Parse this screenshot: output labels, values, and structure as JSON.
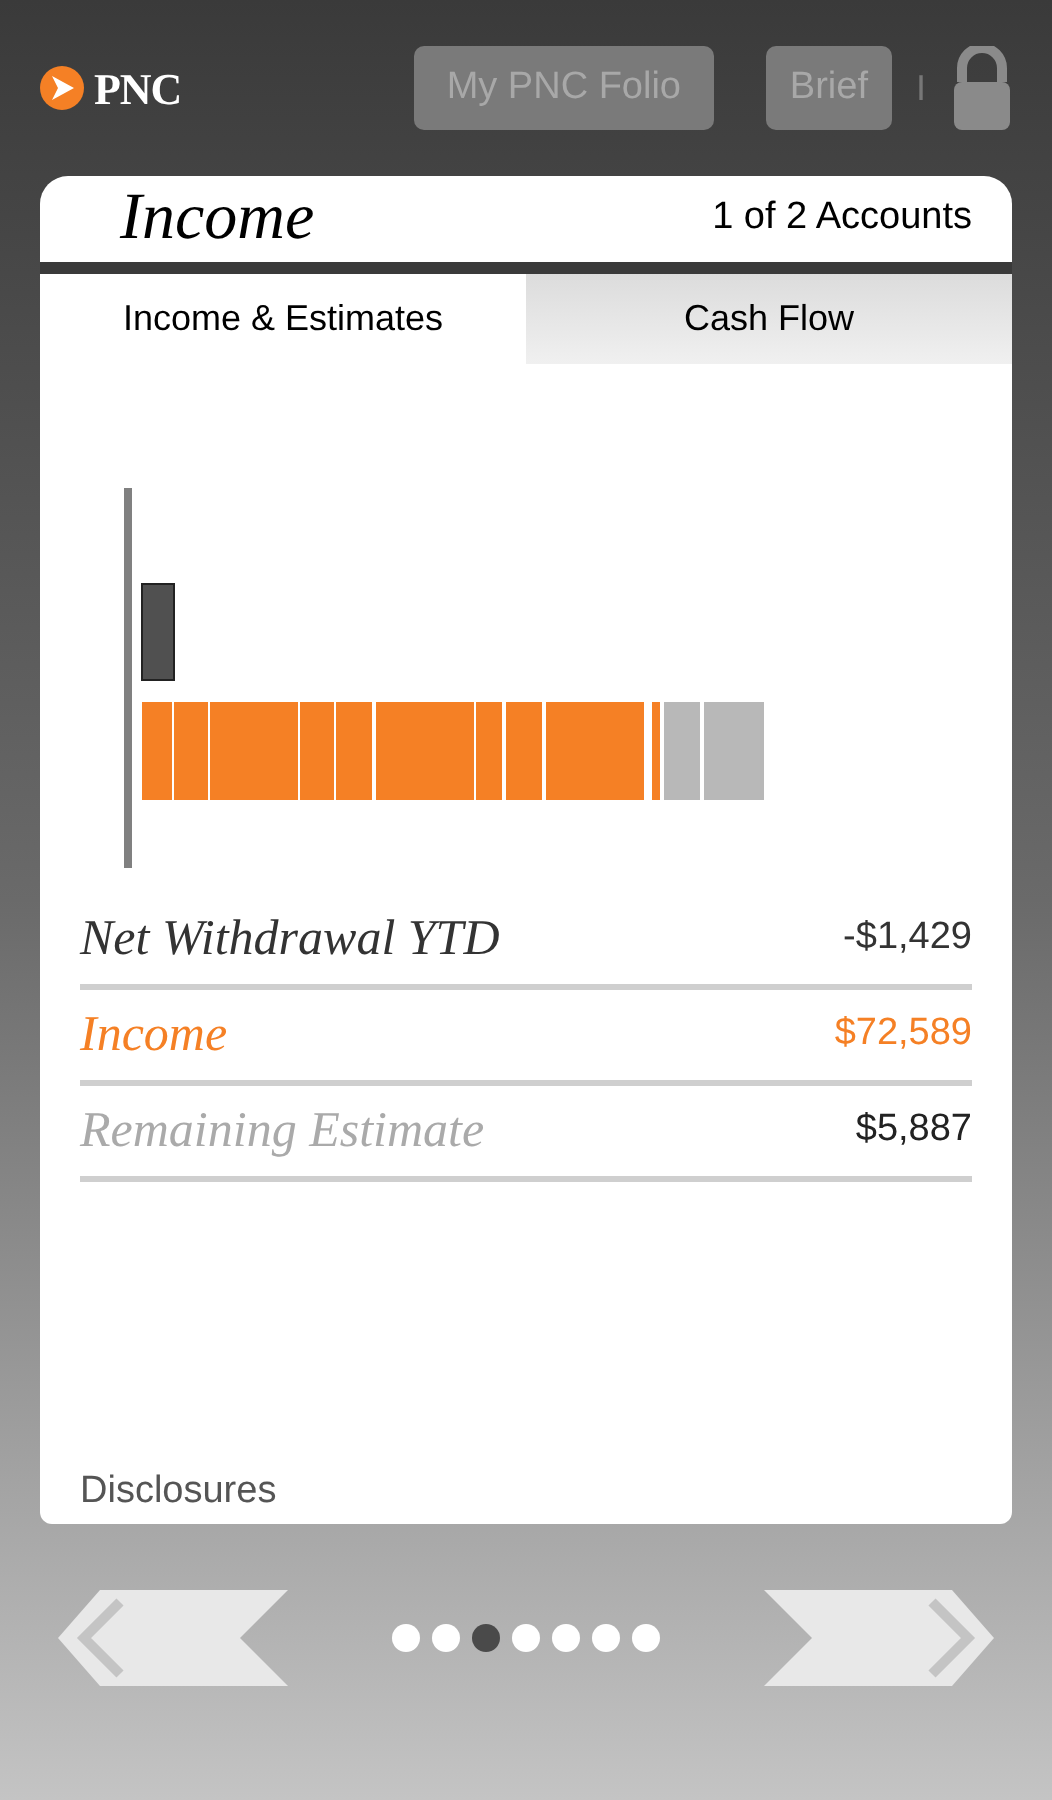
{
  "header": {
    "logo": "PNC",
    "breadcrumb": "My PNC Folio",
    "brief_button": "Brief",
    "separator": "I"
  },
  "card": {
    "title": "Income",
    "account_count": "1 of 2 Accounts",
    "tabs": [
      {
        "label": "Income & Estimates",
        "selected": true
      },
      {
        "label": "Cash Flow",
        "selected": false
      }
    ],
    "rows": [
      {
        "kind": "withdrawal",
        "label": "Net Withdrawal YTD",
        "value": "-$1,429"
      },
      {
        "kind": "income",
        "label": "Income",
        "value": "$72,589"
      },
      {
        "kind": "estimate",
        "label": "Remaining Estimate",
        "value": "$5,887"
      }
    ],
    "disclosures": "Disclosures"
  },
  "pager": [
    {
      "selected": false
    },
    {
      "selected": false
    },
    {
      "selected": true
    },
    {
      "selected": false
    },
    {
      "selected": false
    },
    {
      "selected": false
    },
    {
      "selected": false
    }
  ]
}
